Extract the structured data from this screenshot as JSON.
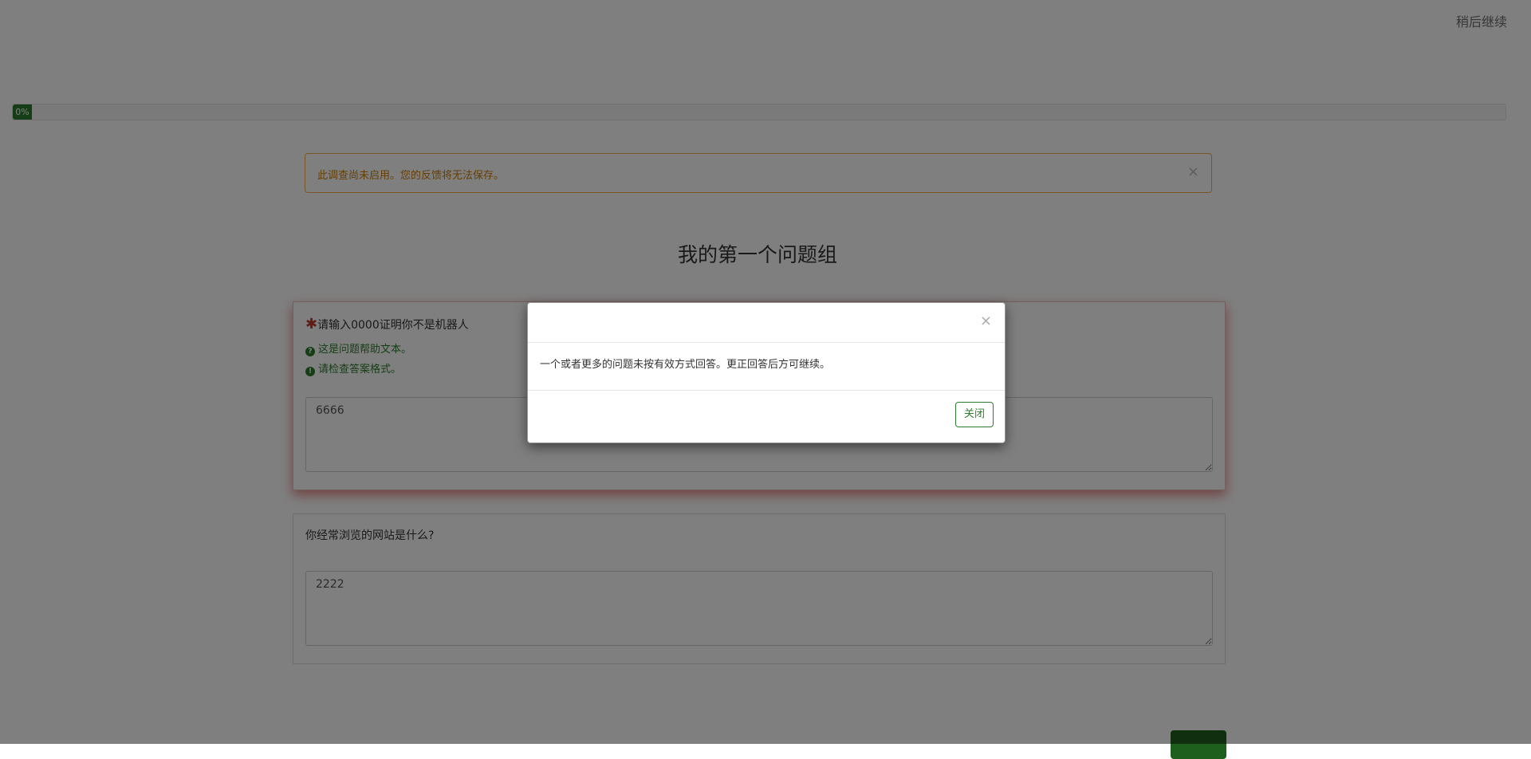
{
  "header": {
    "resume_later_label": "稍后继续"
  },
  "progress": {
    "value_percent": 0,
    "label": "0%"
  },
  "alert": {
    "text": "此调查尚未启用。您的反馈将无法保存。",
    "close_glyph": "×"
  },
  "group": {
    "title": "我的第一个问题组"
  },
  "questions": [
    {
      "required_mark": "✱",
      "label": "请输入0000证明你不是机器人",
      "help_text": "这是问题帮助文本。",
      "help_icon": "question-circle-icon",
      "help_icon_glyph": "?",
      "error_text": "请检查答案格式。",
      "error_icon": "exclamation-circle-icon",
      "error_icon_glyph": "!",
      "answer": "6666"
    },
    {
      "label": "你经常浏览的网站是什么?",
      "answer": "2222"
    }
  ],
  "modal": {
    "close_glyph": "×",
    "message": "一个或者更多的问题未按有效方式回答。更正回答后方可继续。",
    "close_button_label": "关闭"
  },
  "colors": {
    "accent": "#2d7d2d",
    "warning": "#f0ad4e",
    "error": "#c0392b"
  }
}
